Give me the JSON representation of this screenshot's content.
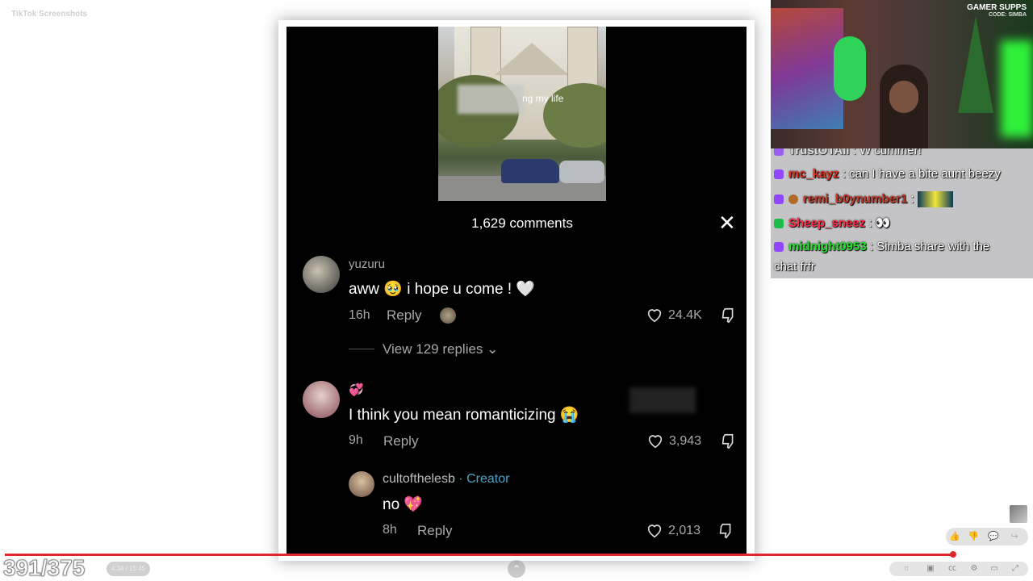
{
  "overlay": {
    "top_label": "TikTok Screenshots"
  },
  "tiktok": {
    "thumb_caption": "ng my life",
    "comments_count": "1,629 comments",
    "comments": [
      {
        "username": "yuzuru",
        "text": "aww 🥹 i hope u come ! 🤍",
        "time": "16h",
        "reply": "Reply",
        "likes": "24.4K"
      },
      {
        "username": "💞",
        "text": "I think you mean romanticizing 😭",
        "time": "9h",
        "reply": "Reply",
        "likes": "3,943"
      },
      {
        "username": "cultofthelesb",
        "creator_tag": "· Creator",
        "text": "no 💖",
        "time": "8h",
        "reply": "Reply",
        "likes": "2,013"
      }
    ],
    "view_replies": "View 129 replies ⌄"
  },
  "stream": {
    "brand": "GAMER SUPPS",
    "brand_code": "CODE: SIMBA",
    "chat": [
      {
        "user": "TrustOTAll",
        "msg": ": W cummer!",
        "badge_color": "#9146ff",
        "user_color": "#e8e8e8"
      },
      {
        "user": "mc_kayz",
        "msg": ": can I have a bite aunt beezy",
        "badge_color": "#9146ff",
        "user_color": "#e0301e"
      },
      {
        "user": "remi_b0ynumber1",
        "msg": ":",
        "badge_color": "#9146ff",
        "user_color": "#c43a2a"
      },
      {
        "user": "Sheep_sneez",
        "msg": ": 👀",
        "badge_color": "#1cbc4a",
        "user_color": "#ff2f4a"
      },
      {
        "user": "midnight0953",
        "msg": ": Simba share with the",
        "msg2": "chat frfr",
        "badge_color": "#9146ff",
        "user_color": "#22e22e"
      }
    ]
  },
  "player": {
    "counter": "391/375",
    "time": "4:34 / 15:45",
    "progress_fraction": 0.924
  }
}
